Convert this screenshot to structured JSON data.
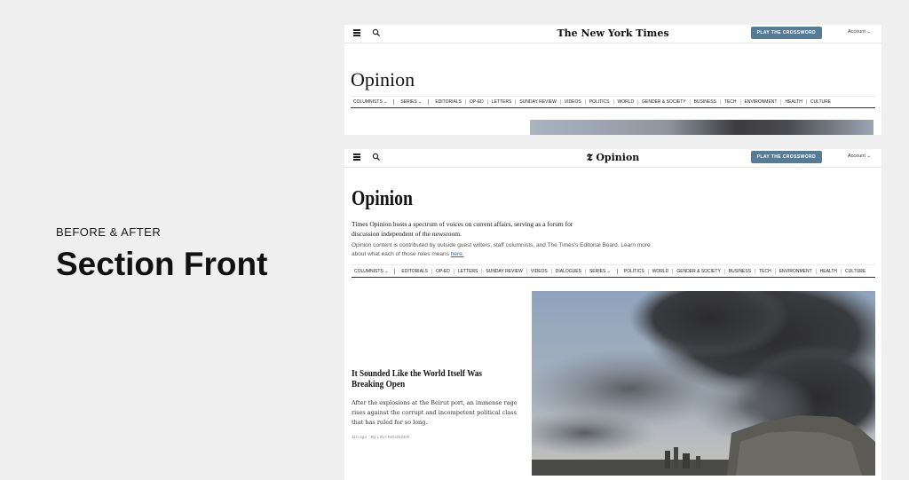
{
  "caption": {
    "kicker": "BEFORE & AFTER",
    "title": "Section Front"
  },
  "before": {
    "masthead": "The New York Times",
    "crossword_button": "PLAY THE CROSSWORD",
    "account": "Account",
    "title": "Opinion",
    "nav": [
      "COLUMNISTS",
      "SERIES",
      "EDITORIALS",
      "OP-ED",
      "LETTERS",
      "SUNDAY REVIEW",
      "VIDEOS",
      "POLITICS",
      "WORLD",
      "GENDER & SOCIETY",
      "BUSINESS",
      "TECH",
      "ENVIRONMENT",
      "HEALTH",
      "CULTURE"
    ]
  },
  "after": {
    "masthead": "Opinion",
    "crossword_button": "PLAY THE CROSSWORD",
    "account": "Account",
    "title": "Opinion",
    "description": "Times Opinion hosts a spectrum of voices on current affairs, serving as a forum for discussion independent of the newsroom.",
    "note": "Opinion content is contributed by outside guest writers, staff columnists, and The Times's Editorial Board. Learn more about what each of those roles means",
    "note_link": "here.",
    "nav": [
      "COLUMNISTS",
      "EDITORIALS",
      "OP-ED",
      "LETTERS",
      "SUNDAY REVIEW",
      "VIDEOS",
      "DIALOGUES",
      "SERIES",
      "POLITICS",
      "WORLD",
      "GENDER & SOCIETY",
      "BUSINESS",
      "TECH",
      "ENVIRONMENT",
      "HEALTH",
      "CULTURE"
    ],
    "article": {
      "headline": "It Sounded Like the World Itself Was Breaking Open",
      "summary": "After the explosions at the Beirut port, an immense rage rises against the corrupt and incompetent political class that has ruled for so long.",
      "byline": "11h ago · By LINA MOUNZER"
    }
  },
  "colors": {
    "crossword_button": "#567b95",
    "link": "#326891",
    "background": "#efefef"
  }
}
